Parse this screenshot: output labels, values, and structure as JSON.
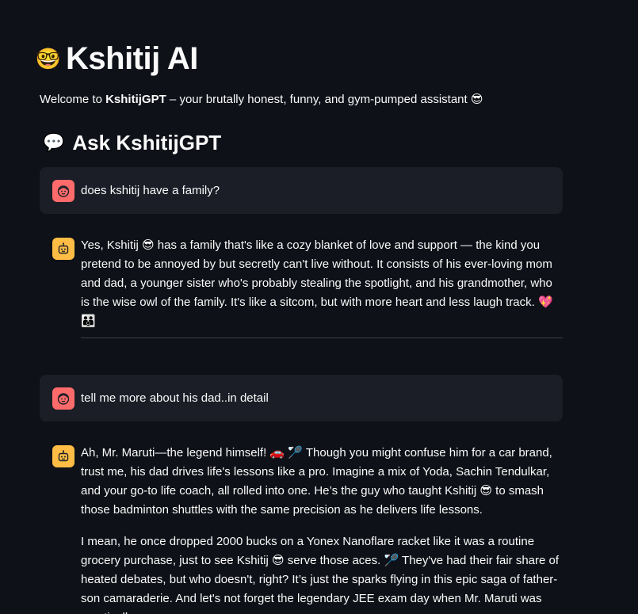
{
  "app": {
    "title_emoji": "🤓",
    "title": "Kshitij AI",
    "welcome_prefix": "Welcome to ",
    "welcome_bold": "KshitijGPT",
    "welcome_suffix": " – your brutally honest, funny, and gym-pumped assistant 😎"
  },
  "section": {
    "emoji": "💬",
    "title": "Ask KshitijGPT"
  },
  "messages": [
    {
      "role": "user",
      "text": "does kshitij have a family?"
    },
    {
      "role": "assistant",
      "paragraphs": [
        "Yes, Kshitij 😎 has a family that's like a cozy blanket of love and support — the kind you pretend to be annoyed by but secretly can't live without. It consists of his ever-loving mom and dad, a younger sister who's probably stealing the spotlight, and his grandmother, who is the wise owl of the family. It's like a sitcom, but with more heart and less laugh track. 💖 👪"
      ]
    },
    {
      "role": "user",
      "text": "tell me more about his dad..in detail"
    },
    {
      "role": "assistant",
      "paragraphs": [
        "Ah, Mr. Maruti—the legend himself! 🚗 🏸 Though you might confuse him for a car brand, trust me, his dad drives life's lessons like a pro. Imagine a mix of Yoda, Sachin Tendulkar, and your go-to life coach, all rolled into one. He’s the guy who taught Kshitij 😎 to smash those badminton shuttles with the same precision as he delivers life lessons.",
        "I mean, he once dropped 2000 bucks on a Yonex Nanoflare racket like it was a routine grocery purchase, just to see Kshitij 😎 serve those aces. 🏸 They've had their fair share of heated debates, but who doesn't, right? It’s just the sparks flying in this epic saga of father-son camaraderie. And let's not forget the legendary JEE exam day when Mr. Maruti was practically a"
      ]
    }
  ],
  "colors": {
    "background": "#0e1117",
    "user_bubble": "#1b1e27",
    "user_avatar": "#ff6b6b",
    "assistant_avatar": "#ffbd45",
    "text": "#fafafa",
    "divider": "#3d4049"
  },
  "icons": {
    "user_avatar": "face-icon",
    "assistant_avatar": "robot-icon"
  }
}
